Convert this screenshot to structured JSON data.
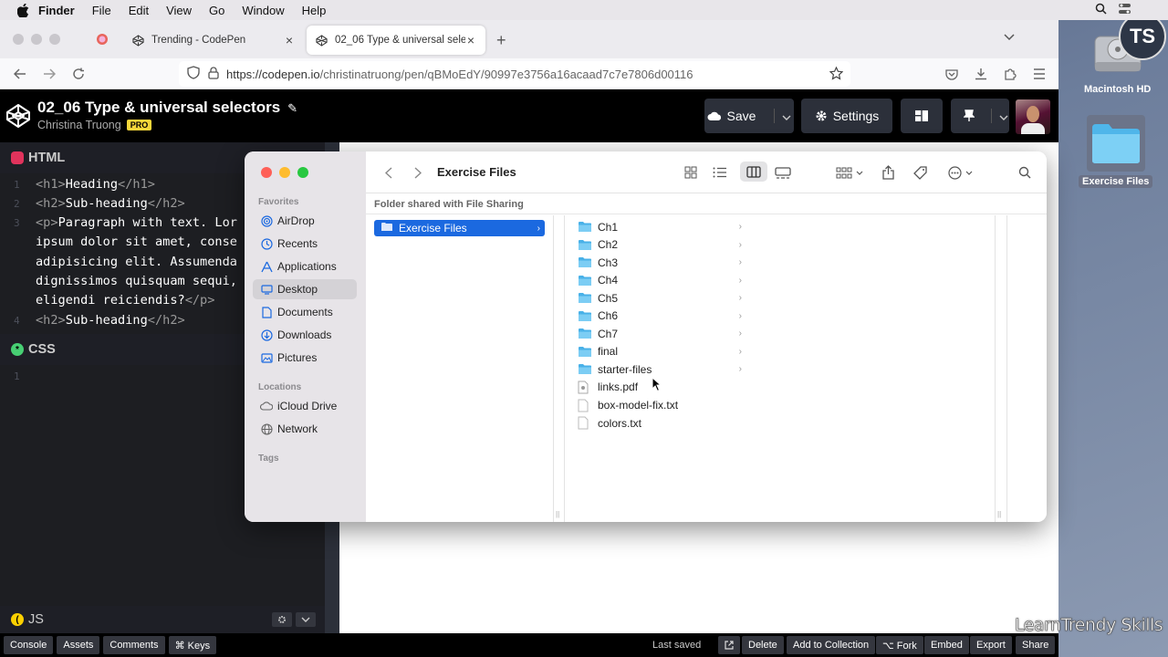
{
  "menubar": {
    "app": "Finder",
    "items": [
      "File",
      "Edit",
      "View",
      "Go",
      "Window",
      "Help"
    ]
  },
  "browser": {
    "tabs": [
      {
        "title": "Trending - CodePen"
      },
      {
        "title": "02_06 Type & universal selectors"
      }
    ],
    "url_host": "https://codepen.io",
    "url_path": "/christinatruong/pen/qBMoEdY/90997e3756a16acaad7c7e7806d00116"
  },
  "codepen": {
    "title": "02_06 Type & universal selectors",
    "author": "Christina Truong",
    "pro": "PRO",
    "save_label": "Save",
    "settings_label": "Settings",
    "panes": {
      "html": "HTML",
      "css": "CSS",
      "js": "JS"
    },
    "html_code": [
      {
        "n": "1"
      },
      {
        "n": "2"
      },
      {
        "n": "3"
      },
      {
        "n": ""
      },
      {
        "n": ""
      },
      {
        "n": ""
      },
      {
        "n": ""
      },
      {
        "n": "4"
      }
    ],
    "html_text": {
      "l1_open": "<h1>",
      "l1_text": "Heading",
      "l1_close": "</h1>",
      "l2_open": "<h2>",
      "l2_text": "Sub-heading",
      "l2_close": "</h2>",
      "l3_open": "<p>",
      "l3_text": "Paragraph with text. Lor",
      "l4": "ipsum dolor sit amet, conse",
      "l5": "adipisicing elit. Assumenda",
      "l6": "dignissimos quisquam sequi,",
      "l7_text": "eligendi reiciendis?",
      "l7_close": "</p>",
      "l8_open": "<h2>",
      "l8_text": "Sub-heading",
      "l8_close": "</h2>"
    },
    "css_line": "1",
    "footer": {
      "console": "Console",
      "assets": "Assets",
      "comments": "Comments",
      "keys": "⌘ Keys",
      "last_saved": "Last saved",
      "delete": "Delete",
      "add_to_collection": "Add to Collection",
      "fork": "⌥ Fork",
      "embed": "Embed",
      "export": "Export",
      "share": "Share"
    }
  },
  "finder": {
    "title": "Exercise Files",
    "path_label": "Folder shared with File Sharing",
    "favorites_label": "Favorites",
    "locations_label": "Locations",
    "tags_label": "Tags",
    "favorites": [
      "AirDrop",
      "Recents",
      "Applications",
      "Desktop",
      "Documents",
      "Downloads",
      "Pictures"
    ],
    "locations": [
      "iCloud Drive",
      "Network"
    ],
    "selected_folder": "Exercise Files",
    "items": [
      {
        "name": "Ch1",
        "kind": "folder"
      },
      {
        "name": "Ch2",
        "kind": "folder"
      },
      {
        "name": "Ch3",
        "kind": "folder"
      },
      {
        "name": "Ch4",
        "kind": "folder"
      },
      {
        "name": "Ch5",
        "kind": "folder"
      },
      {
        "name": "Ch6",
        "kind": "folder"
      },
      {
        "name": "Ch7",
        "kind": "folder"
      },
      {
        "name": "final",
        "kind": "folder"
      },
      {
        "name": "starter-files",
        "kind": "folder"
      },
      {
        "name": "links.pdf",
        "kind": "file"
      },
      {
        "name": "box-model-fix.txt",
        "kind": "file"
      },
      {
        "name": "colors.txt",
        "kind": "file"
      }
    ]
  },
  "desktop": {
    "hd_label": "Macintosh HD",
    "folder_label": "Exercise Files",
    "watermark": "LearnTrendy Skills",
    "logo_text": "TS"
  },
  "colors": {
    "finder_selection": "#1b69e0",
    "folder_blue": "#6cc3ee",
    "codepen_black": "#000000",
    "pro_yellow": "#f5d63a"
  }
}
